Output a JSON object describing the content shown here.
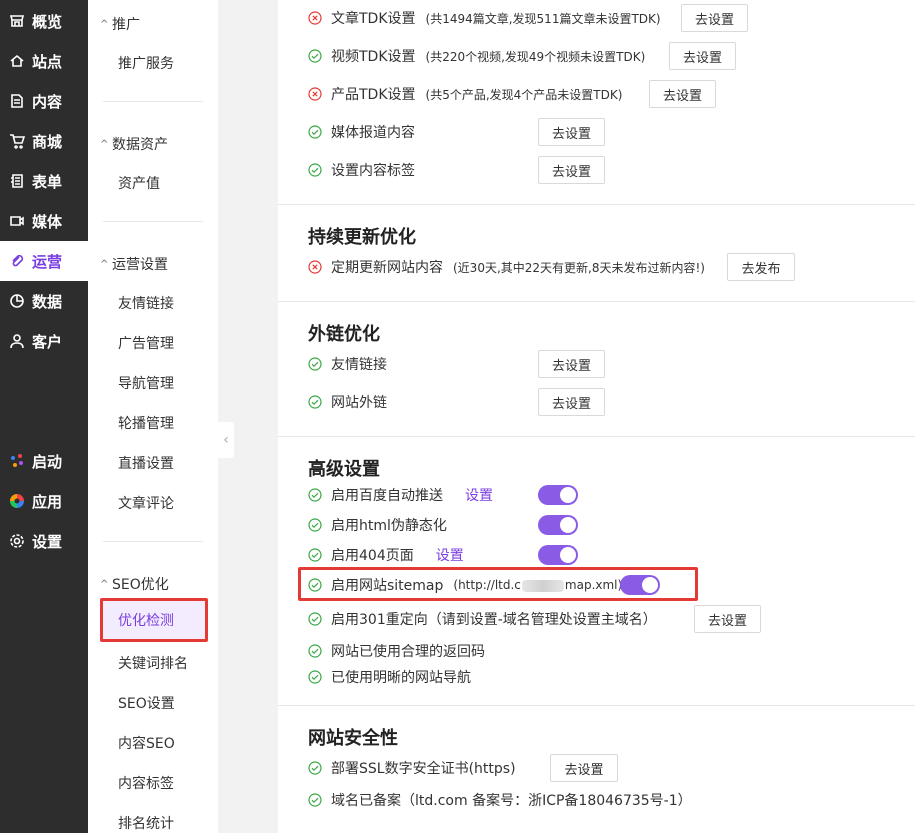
{
  "nav": {
    "items": [
      {
        "label": "概览",
        "icon": "storefront-icon"
      },
      {
        "label": "站点",
        "icon": "home-icon"
      },
      {
        "label": "内容",
        "icon": "document-icon"
      },
      {
        "label": "商城",
        "icon": "cart-icon"
      },
      {
        "label": "表单",
        "icon": "form-icon"
      },
      {
        "label": "媒体",
        "icon": "video-icon"
      },
      {
        "label": "运营",
        "icon": "paperclip-icon",
        "active": true
      },
      {
        "label": "数据",
        "icon": "pie-chart-icon"
      },
      {
        "label": "客户",
        "icon": "user-icon"
      }
    ],
    "bottom": [
      {
        "label": "启动",
        "icon": "dots-icon"
      },
      {
        "label": "应用",
        "icon": "colorwheel-icon"
      },
      {
        "label": "设置",
        "icon": "gear-icon"
      }
    ]
  },
  "sub": {
    "groups": [
      {
        "title": "推广",
        "items": [
          "推广服务"
        ]
      },
      {
        "title": "数据资产",
        "items": [
          "资产值"
        ]
      },
      {
        "title": "运营设置",
        "items": [
          "友情链接",
          "广告管理",
          "导航管理",
          "轮播管理",
          "直播设置",
          "文章评论"
        ]
      },
      {
        "title": "SEO优化",
        "items": [
          "优化检测",
          "关键词排名",
          "SEO设置",
          "内容SEO",
          "内容标签",
          "排名统计"
        ]
      }
    ]
  },
  "main": {
    "rows_top": [
      {
        "status": "error",
        "label": "文章TDK设置",
        "note": "(共1494篇文章,发现511篇文章未设置TDK)",
        "button": "去设置"
      },
      {
        "status": "ok",
        "label": "视频TDK设置",
        "note": "(共220个视频,发现49个视频未设置TDK)",
        "button": "去设置"
      },
      {
        "status": "error",
        "label": "产品TDK设置",
        "note": "(共5个产品,发现4个产品未设置TDK)",
        "button": "去设置"
      },
      {
        "status": "ok",
        "label": "媒体报道内容",
        "note": "",
        "button": "去设置"
      },
      {
        "status": "ok",
        "label": "设置内容标签",
        "note": "",
        "button": "去设置"
      }
    ],
    "section_update": {
      "title": "持续更新优化",
      "row": {
        "status": "error",
        "label": "定期更新网站内容",
        "note": "(近30天,其中22天有更新,8天未发布过新内容!)",
        "button": "去发布"
      }
    },
    "section_links": {
      "title": "外链优化",
      "rows": [
        {
          "status": "ok",
          "label": "友情链接",
          "button": "去设置"
        },
        {
          "status": "ok",
          "label": "网站外链",
          "button": "去设置"
        }
      ]
    },
    "section_advanced": {
      "title": "高级设置",
      "baidu": {
        "label": "启用百度自动推送",
        "link": "设置"
      },
      "html": {
        "label": "启用html伪静态化"
      },
      "p404": {
        "label": "启用404页面",
        "link": "设置"
      },
      "sitemap": {
        "label": "启用网站sitemap",
        "note_pre": "(http://ltd.c",
        "note_post": "map.xml)"
      },
      "redirect": {
        "label": "启用301重定向（请到设置-域名管理处设置主域名）",
        "button": "去设置"
      },
      "codes": {
        "label": "网站已使用合理的返回码"
      },
      "navi": {
        "label": "已使用明晰的网站导航"
      }
    },
    "section_security": {
      "title": "网站安全性",
      "ssl": {
        "label": "部署SSL数字安全证书(https)",
        "button": "去设置"
      },
      "icp": {
        "label": "域名已备案（ltd.com 备案号：浙ICP备18046735号-1）"
      }
    }
  },
  "colors": {
    "accent": "#7a3fe0",
    "ok": "#3aa845",
    "error": "#e53935",
    "highlight": "#e53935"
  }
}
